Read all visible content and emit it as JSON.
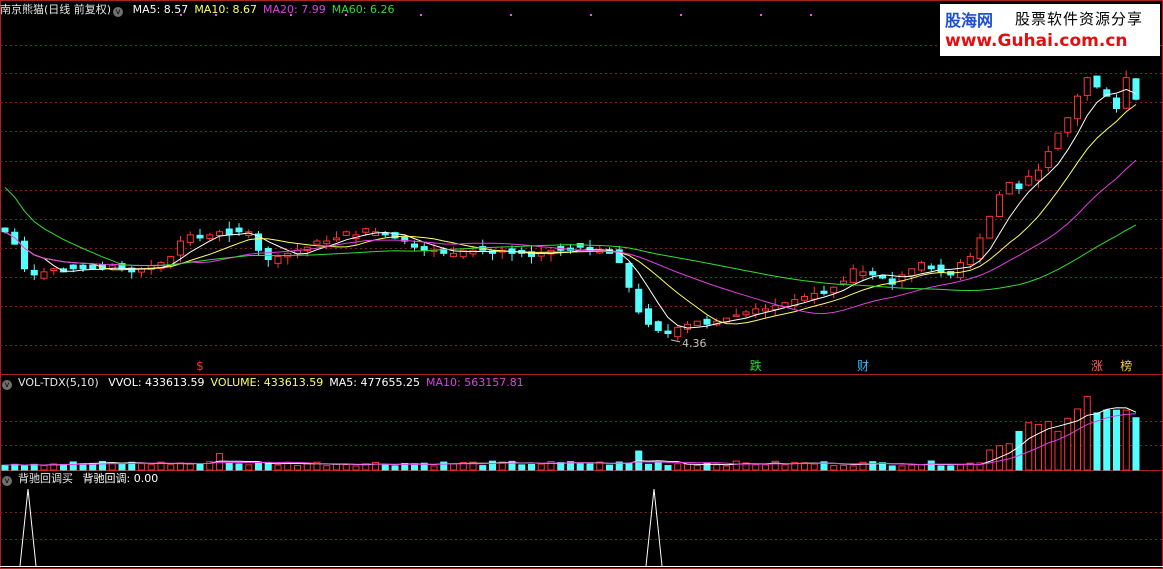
{
  "main_panel": {
    "stock_name": "南京熊猫",
    "period_label": "(日线 前复权)",
    "ma_labels": [
      {
        "text": "MA5: 8.57",
        "color": "#ffffff"
      },
      {
        "text": "MA10: 8.67",
        "color": "#ffff66"
      },
      {
        "text": "MA20: 7.99",
        "color": "#e040e0"
      },
      {
        "text": "MA60: 6.26",
        "color": "#33dd33"
      }
    ],
    "low_price_label": "4.36",
    "markers": [
      {
        "text": "$",
        "color": "#ff3030"
      },
      {
        "text": "跌",
        "color": "#33dd33"
      },
      {
        "text": "财",
        "color": "#33bbff"
      },
      {
        "text": "涨",
        "color": "#ff6060"
      },
      {
        "text": "榜",
        "color": "#ffcc33"
      }
    ]
  },
  "volume_panel": {
    "indicator_name": "VOL-TDX(5,10)",
    "labels": [
      {
        "text": "VVOL: 433613.59",
        "color": "#ffffff"
      },
      {
        "text": "VOLUME: 433613.59",
        "color": "#ffff66"
      },
      {
        "text": "MA5: 477655.25",
        "color": "#ffffff"
      },
      {
        "text": "MA10: 563157.81",
        "color": "#e040e0"
      }
    ]
  },
  "signal_panel": {
    "indicator_name": "背驰回调买",
    "value_label": "背驰回调: 0.00"
  },
  "watermark": {
    "line1_cn": "股海网",
    "line1_tail": "股票软件资源分享",
    "line2": "www.Guhai.com.cn"
  },
  "colors": {
    "up": "#ff3232",
    "down": "#54ffff",
    "grid": "#8a1f1f",
    "border": "#aa2222",
    "ma5": "#ffffff",
    "ma10": "#ffff66",
    "ma20": "#e040e0",
    "ma60": "#33dd33"
  },
  "chart_data": {
    "type": "candlestick",
    "close_price_path": [
      7.8,
      7.4,
      6.6,
      6.4,
      6.5,
      6.6,
      6.5,
      6.6,
      6.6,
      6.6,
      6.6,
      6.7,
      6.6,
      6.5,
      6.6,
      6.7,
      6.8,
      7.0,
      7.5,
      7.7,
      7.6,
      7.7,
      7.8,
      7.7,
      7.8,
      7.8,
      7.2,
      6.9,
      7.0,
      7.1,
      7.2,
      7.3,
      7.5,
      7.5,
      7.6,
      7.8,
      7.7,
      7.9,
      7.8,
      7.7,
      7.6,
      7.5,
      7.3,
      7.2,
      7.2,
      7.1,
      7.1,
      7.2,
      7.2,
      7.2,
      7.1,
      7.2,
      7.1,
      7.1,
      7.0,
      7.1,
      7.2,
      7.2,
      7.2,
      7.3,
      7.2,
      7.2,
      7.1,
      6.8,
      6.0,
      5.2,
      4.8,
      4.6,
      4.5,
      4.7,
      4.8,
      4.9,
      4.8,
      4.9,
      5.0,
      5.1,
      5.2,
      5.3,
      5.3,
      5.4,
      5.5,
      5.6,
      5.7,
      5.8,
      5.8,
      6.0,
      6.2,
      6.6,
      6.5,
      6.4,
      6.3,
      6.1,
      6.4,
      6.6,
      6.8,
      6.6,
      6.5,
      6.4,
      6.8,
      7.0,
      7.6,
      8.3,
      9.0,
      9.4,
      9.2,
      9.6,
      9.8,
      10.4,
      11.0,
      11.5,
      12.2,
      12.8,
      12.5,
      12.2,
      11.8,
      12.8,
      12.1
    ],
    "low_point": 4.36,
    "signal_spikes": [
      "left",
      "middle"
    ]
  }
}
